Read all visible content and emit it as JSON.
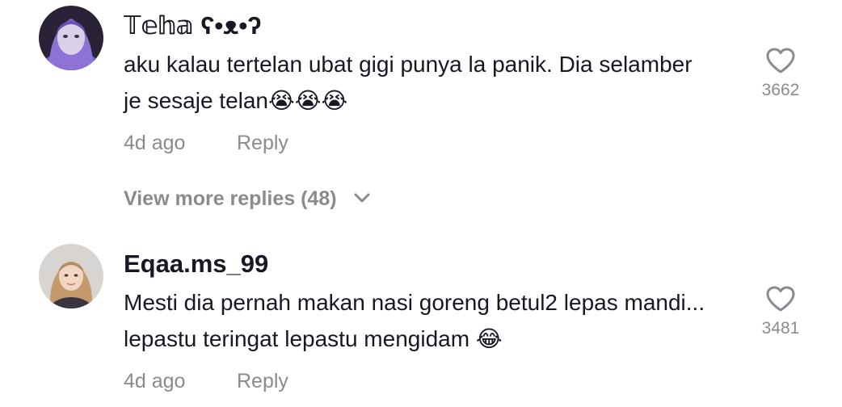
{
  "comments": [
    {
      "username": "𝕋𝕖𝕙𝕒 ʕ•ᴥ•ʔ",
      "text": "aku kalau tertelan ubat gigi punya la panik. Dia selamber je sesaje telan😭😭😭",
      "time": "4d ago",
      "reply_label": "Reply",
      "like_count": "3662",
      "like_icon": "heart-outline-icon",
      "avatar": "user-avatar"
    },
    {
      "username": "Eqaa.ms_99",
      "text": "Mesti dia pernah makan nasi goreng betul2 lepas mandi... lepastu teringat lepastu mengidam 😂",
      "time": "4d ago",
      "reply_label": "Reply",
      "like_count": "3481",
      "like_icon": "heart-outline-icon",
      "avatar": "user-avatar"
    }
  ],
  "view_more_replies": {
    "label": "View more replies (48)",
    "icon": "chevron-down-icon"
  },
  "colors": {
    "text_primary": "#161823",
    "text_secondary": "#8a8b91",
    "background": "#ffffff"
  }
}
